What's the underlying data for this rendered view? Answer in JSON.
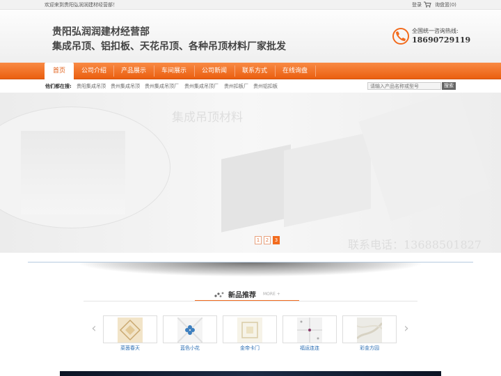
{
  "topbar": {
    "welcome": "欢迎来到贵阳弘润润建材经营部！",
    "login": "登录",
    "cart": "询盘篮(0)",
    "cart_icon": "cart-icon"
  },
  "header": {
    "line1": "贵阳弘润润建材经营部",
    "line2": "集成吊顶、铝扣板、天花吊顶、各种吊顶材料厂家批发",
    "hotline_label": "全国统一咨询热线:",
    "hotline": "18690729119",
    "phone_icon": "phone-icon"
  },
  "nav": {
    "items": [
      {
        "label": "首页",
        "active": true
      },
      {
        "label": "公司介绍"
      },
      {
        "label": "产品展示"
      },
      {
        "label": "车间展示"
      },
      {
        "label": "公司新闻"
      },
      {
        "label": "联系方式"
      },
      {
        "label": "在线询盘"
      }
    ]
  },
  "tags": {
    "lead": "他们都在搜:",
    "items": [
      "贵阳集成吊顶",
      "贵州集成吊顶",
      "贵州集成吊顶厂",
      "贵州集成吊顶厂",
      "贵州扣板厂",
      "贵州铝扣板"
    ]
  },
  "search": {
    "placeholder": "请输入产品名称或型号",
    "button": "搜索"
  },
  "banner": {
    "title": "集成吊顶材料",
    "phone": "联系电话：13688501827",
    "pages": [
      "1",
      "2",
      "3"
    ],
    "active_page": "3"
  },
  "section": {
    "title": "新品推荐",
    "more": "MORE +",
    "icon": "dots-icon"
  },
  "products": [
    {
      "name": "菜茵春天"
    },
    {
      "name": "蓝色小花"
    },
    {
      "name": "金帝卡门"
    },
    {
      "name": "福运连连"
    },
    {
      "name": "彩金方园"
    }
  ],
  "colors": {
    "accent": "#f26b1d",
    "link": "#2a6db3"
  }
}
